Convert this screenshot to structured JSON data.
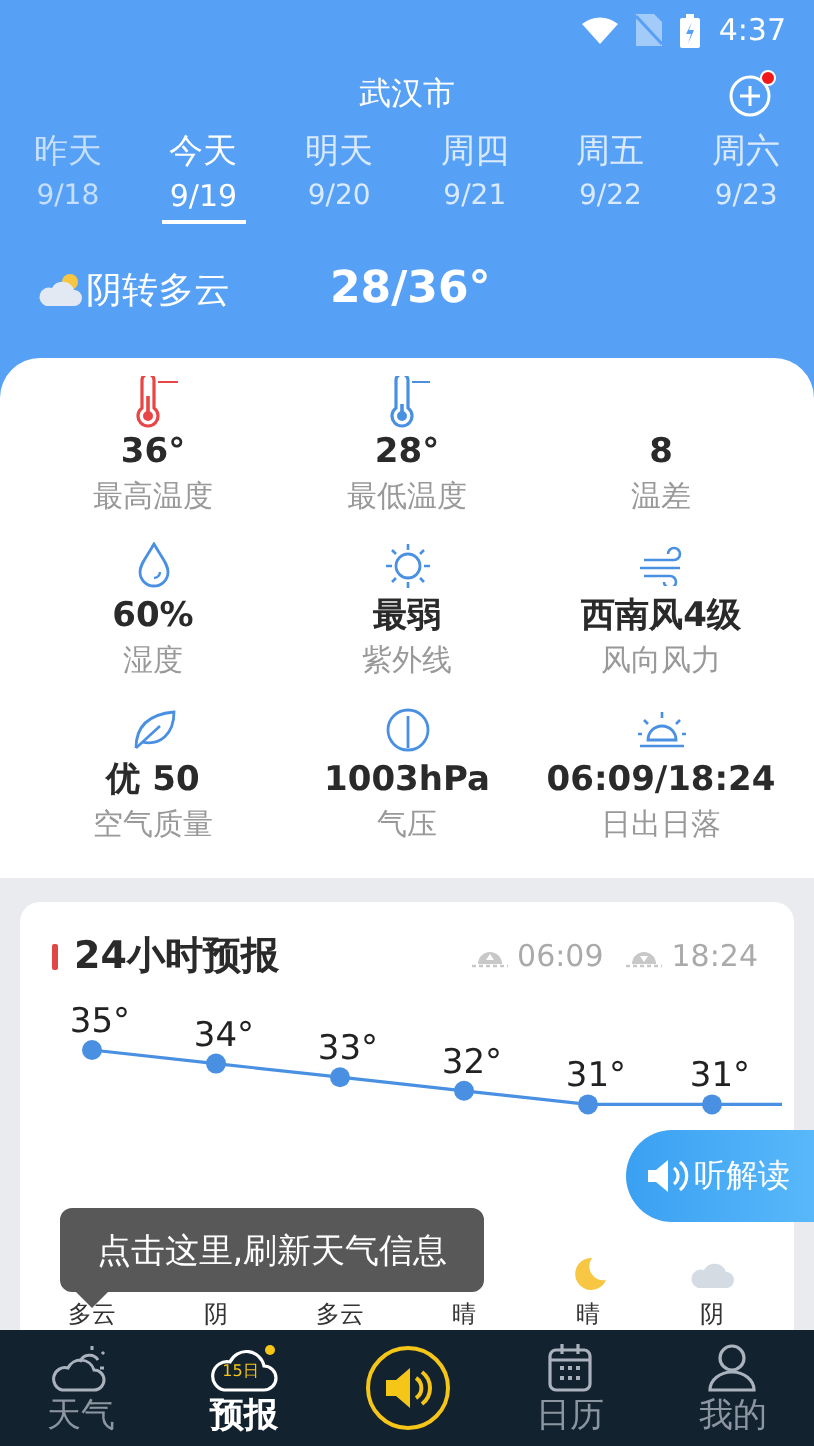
{
  "status_bar": {
    "time": "4:37"
  },
  "city": "武汉市",
  "add_button": {
    "has_notification": true
  },
  "days": [
    {
      "day": "昨天",
      "date": "9/18",
      "selected": false,
      "past": true
    },
    {
      "day": "今天",
      "date": "9/19",
      "selected": true,
      "past": false
    },
    {
      "day": "明天",
      "date": "9/20",
      "selected": false,
      "past": false
    },
    {
      "day": "周四",
      "date": "9/21",
      "selected": false,
      "past": false
    },
    {
      "day": "周五",
      "date": "9/22",
      "selected": false,
      "past": false
    },
    {
      "day": "周六",
      "date": "9/23",
      "selected": false,
      "past": false
    }
  ],
  "summary": {
    "condition": "阴转多云",
    "temperature": "28/36°"
  },
  "details": [
    {
      "kind": "max_temp",
      "value": "36°",
      "label": "最高温度"
    },
    {
      "kind": "min_temp",
      "value": "28°",
      "label": "最低温度"
    },
    {
      "kind": "diff",
      "value": "8",
      "label": "温差"
    },
    {
      "kind": "humidity",
      "value": "60%",
      "label": "湿度"
    },
    {
      "kind": "uv",
      "value": "最弱",
      "label": "紫外线"
    },
    {
      "kind": "wind",
      "value": "西南风4级",
      "label": "风向风力"
    },
    {
      "kind": "air",
      "value": "优 50",
      "label": "空气质量"
    },
    {
      "kind": "pressure",
      "value": "1003hPa",
      "label": "气压"
    },
    {
      "kind": "sun",
      "value": "06:09/18:24",
      "label": "日出日落"
    }
  ],
  "hourly": {
    "title": "24小时预报",
    "sunrise": "06:09",
    "sunset": "18:24",
    "hours": [
      {
        "temperature": "35°",
        "condition": "多云"
      },
      {
        "temperature": "34°",
        "condition": "阴"
      },
      {
        "temperature": "33°",
        "condition": "多云"
      },
      {
        "temperature": "32°",
        "condition": "晴"
      },
      {
        "temperature": "31°",
        "condition": "晴",
        "kind": "moon"
      },
      {
        "temperature": "31°",
        "condition": "阴",
        "kind": "cloud"
      }
    ]
  },
  "listen_button": "听解读",
  "tooltip": "点击这里,刷新天气信息",
  "nav": [
    {
      "kind": "weather",
      "label": "天气",
      "selected": false
    },
    {
      "kind": "forecast",
      "label": "预报",
      "badge": "15日",
      "selected": true
    },
    {
      "kind": "speaker"
    },
    {
      "kind": "calendar",
      "label": "日历",
      "selected": false
    },
    {
      "kind": "profile",
      "label": "我的",
      "selected": false
    }
  ]
}
